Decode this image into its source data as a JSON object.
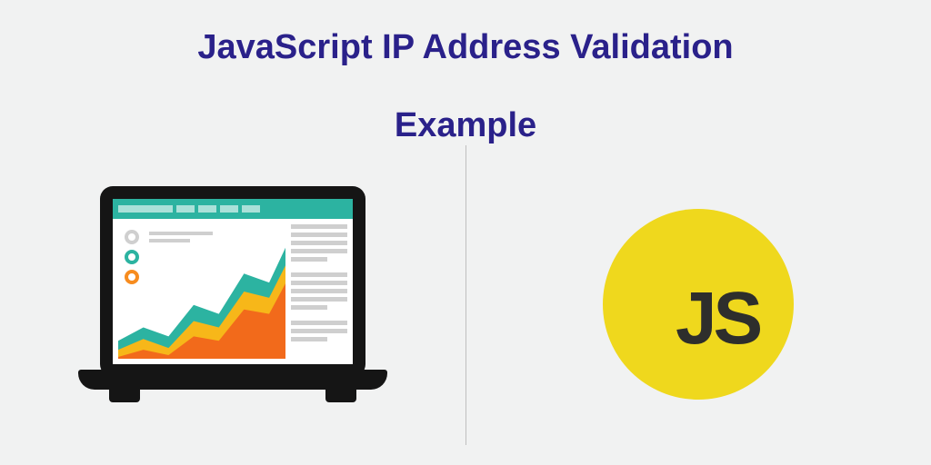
{
  "title_line1": "JavaScript IP Address Validation",
  "title_line2": "Example",
  "js_logo": {
    "text": "JS"
  }
}
